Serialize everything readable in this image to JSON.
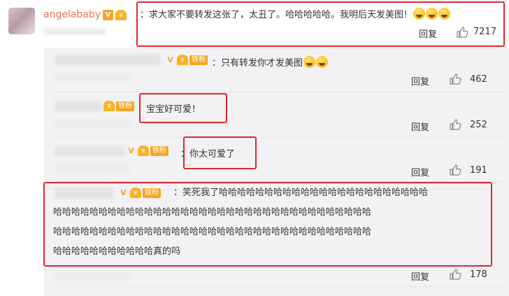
{
  "main_comment": {
    "username": "angelababy",
    "text": "：求大家不要转发这张了，太丑了。哈哈哈哈哈。我明后天发美图！",
    "reply_label": "回复",
    "likes": "7217"
  },
  "badge": {
    "v_label": "V",
    "fan_label": "铁粉"
  },
  "replies": [
    {
      "text": "：只有转发你才发美图",
      "reply_label": "回复",
      "likes": "462"
    },
    {
      "text": "宝宝好可爱！",
      "reply_label": "回复",
      "likes": "252"
    },
    {
      "text": "：你太可爱了",
      "reply_label": "回复",
      "likes": "191"
    },
    {
      "line1": "：笑死我了哈哈哈哈哈哈哈哈哈哈哈哈哈哈哈哈哈哈哈哈哈哈哈",
      "line2": "哈哈哈哈哈哈哈哈哈哈哈哈哈哈哈哈哈哈哈哈哈哈哈哈哈哈哈哈哈哈哈哈哈哈哈",
      "line3": "哈哈哈哈哈哈哈哈哈哈哈哈哈哈哈哈哈哈哈哈哈哈哈哈哈哈哈哈哈哈哈哈哈哈哈",
      "line4": "哈哈哈哈哈哈哈哈哈哈哈真的吗",
      "reply_label": "回复",
      "likes": "178"
    }
  ],
  "colors": {
    "username": "#eb7350",
    "highlight": "#e0262f",
    "panel": "#f2f2f5"
  }
}
